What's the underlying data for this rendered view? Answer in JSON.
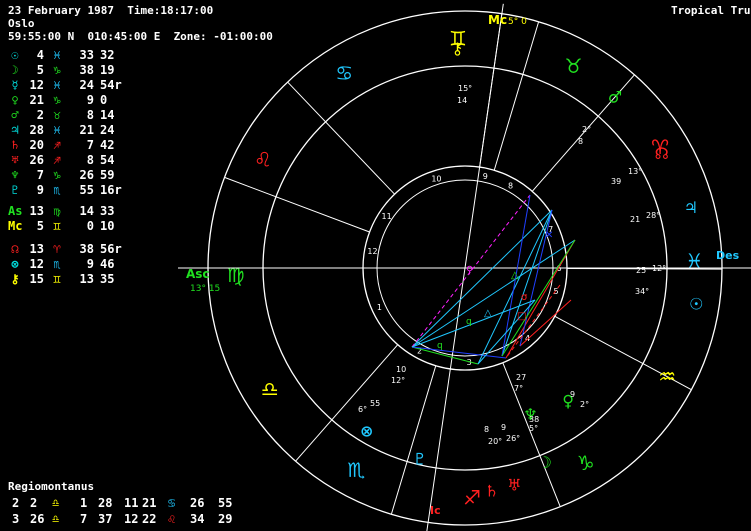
{
  "header": {
    "date_time": "23 February 1987  Time:18:17:00",
    "place": "Oslo",
    "coords": "59:55:00 N  010:45:00 E  Zone: -01:00:00",
    "mode": "Tropical True"
  },
  "colors": {
    "fire": "#ff2020",
    "earth": "#20e020",
    "air": "#ffff00",
    "water": "#20c8ff",
    "planet_cyan": "#00e0e0",
    "violet": "#ff20ff",
    "white": "#ffffff"
  },
  "planets": [
    {
      "glyph": "☉",
      "name": "sun-icon",
      "deg": "4",
      "sign": "♓",
      "min": "33",
      "sec": "32",
      "color": "#00e0e0"
    },
    {
      "glyph": "☽",
      "name": "moon-icon",
      "deg": "5",
      "sign": "♑",
      "min": "38",
      "sec": "19",
      "color": "#20e020"
    },
    {
      "glyph": "☿",
      "name": "mercury-icon",
      "deg": "12",
      "sign": "♓",
      "min": "24",
      "sec": "54r",
      "color": "#00e0e0"
    },
    {
      "glyph": "♀",
      "name": "venus-icon",
      "deg": "21",
      "sign": "♑",
      "min": "9",
      "sec": "0",
      "color": "#20e020"
    },
    {
      "glyph": "♂",
      "name": "mars-icon",
      "deg": "2",
      "sign": "♉",
      "min": "8",
      "sec": "14",
      "color": "#20e020"
    },
    {
      "glyph": "♃",
      "name": "jupiter-icon",
      "deg": "28",
      "sign": "♓",
      "min": "21",
      "sec": "24",
      "color": "#00e0e0"
    },
    {
      "glyph": "♄",
      "name": "saturn-icon",
      "deg": "20",
      "sign": "♐",
      "min": "7",
      "sec": "42",
      "color": "#ff2020"
    },
    {
      "glyph": "♅",
      "name": "uranus-icon",
      "deg": "26",
      "sign": "♐",
      "min": "8",
      "sec": "54",
      "color": "#ff2020"
    },
    {
      "glyph": "♆",
      "name": "neptune-icon",
      "deg": "7",
      "sign": "♑",
      "min": "26",
      "sec": "59",
      "color": "#20e020"
    },
    {
      "glyph": "♇",
      "name": "pluto-icon",
      "deg": "9",
      "sign": "♏",
      "min": "55",
      "sec": "16r",
      "color": "#00e0e0"
    },
    {
      "glyph": "As",
      "name": "ascendant-label",
      "deg": "13",
      "sign": "♍",
      "min": "14",
      "sec": "33",
      "color": "#20e020"
    },
    {
      "glyph": "Mc",
      "name": "midheaven-label",
      "deg": "5",
      "sign": "♊",
      "min": "0",
      "sec": "10",
      "color": "#ffff00"
    },
    {
      "glyph": "☊",
      "name": "north-node-icon",
      "deg": "13",
      "sign": "♈",
      "min": "38",
      "sec": "56r",
      "color": "#ff2020"
    },
    {
      "glyph": "⊗",
      "name": "part-of-fortune-icon",
      "deg": "12",
      "sign": "♏",
      "min": "9",
      "sec": "46",
      "color": "#00e0e0"
    },
    {
      "glyph": "⚷",
      "name": "chiron-icon",
      "deg": "15",
      "sign": "♊",
      "min": "13",
      "sec": "35",
      "color": "#ffff00"
    }
  ],
  "houses": {
    "title": "Regiomontanus",
    "rows": [
      [
        "2",
        "2",
        "♎",
        "1",
        "28",
        "11",
        "21",
        "♋",
        "26",
        "55"
      ],
      [
        "3",
        "26",
        "♎",
        "7",
        "37",
        "12",
        "22",
        "♌",
        "34",
        "29"
      ]
    ]
  },
  "wheel": {
    "angles": {
      "asc": "Asc",
      "asc_deg": "13° 15",
      "mc": "Mc",
      "mc_deg": "5° 0",
      "des": "Des",
      "ic": "Ic"
    },
    "house_numbers": [
      "1",
      "2",
      "3",
      "4",
      "5",
      "6",
      "7",
      "8",
      "9",
      "10",
      "11",
      "12"
    ],
    "signs": [
      "♈",
      "♉",
      "♊",
      "♋",
      "♌",
      "♍",
      "♎",
      "♏",
      "♐",
      "♑",
      "♒",
      "♓"
    ],
    "planet_labels": [
      "2°",
      "8",
      "39",
      "13°",
      "21",
      "28°",
      "25",
      "12°",
      "34°",
      "15°",
      "14",
      "10",
      "12°",
      "6°",
      "55",
      "8",
      "9",
      "20°",
      "26°",
      "27",
      "7°",
      "38",
      "5°",
      "2°",
      "9"
    ],
    "aspect_labels": [
      "q",
      "q"
    ]
  }
}
